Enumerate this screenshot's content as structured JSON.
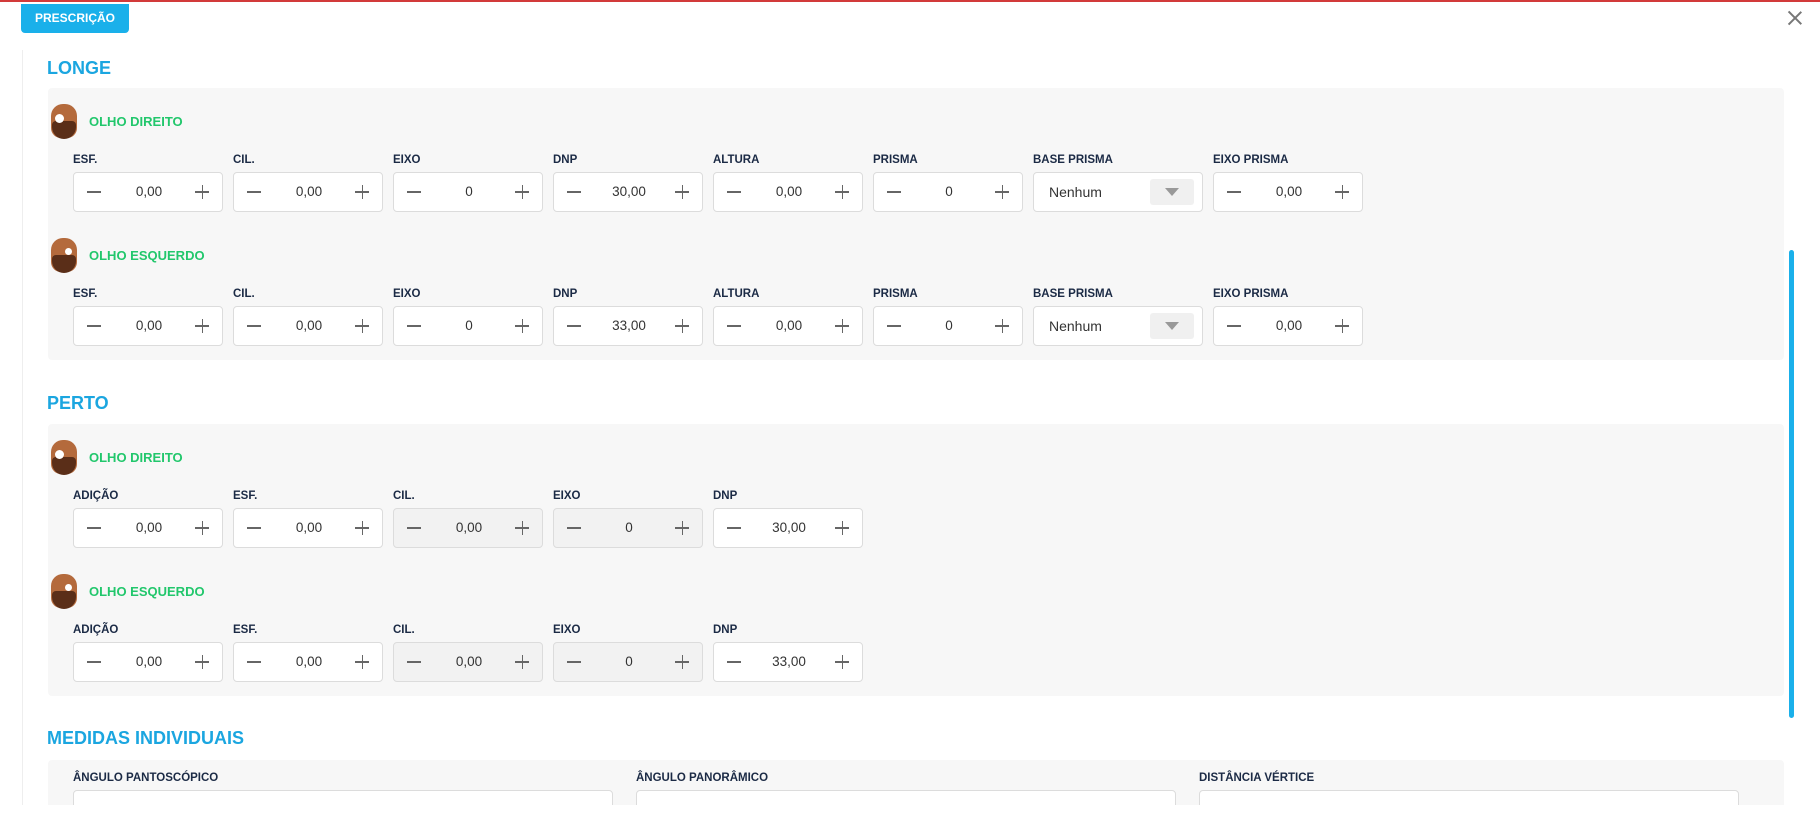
{
  "modal": {
    "tag_label": "PRESCRIÇÃO"
  },
  "longe": {
    "title": "LONGE",
    "olho_direito": {
      "label": "OLHO DIREITO",
      "fields": [
        {
          "label": "ESF.",
          "value": "0,00"
        },
        {
          "label": "CIL.",
          "value": "0,00"
        },
        {
          "label": "EIXO",
          "value": "0"
        },
        {
          "label": "DNP",
          "value": "30,00"
        },
        {
          "label": "ALTURA",
          "value": "0,00"
        },
        {
          "label": "PRISMA",
          "value": "0"
        }
      ],
      "base_prisma": {
        "label": "BASE PRISMA",
        "value": "Nenhum"
      },
      "eixo_prisma": {
        "label": "EIXO PRISMA",
        "value": "0,00"
      }
    },
    "olho_esquerdo": {
      "label": "OLHO ESQUERDO",
      "fields": [
        {
          "label": "ESF.",
          "value": "0,00"
        },
        {
          "label": "CIL.",
          "value": "0,00"
        },
        {
          "label": "EIXO",
          "value": "0"
        },
        {
          "label": "DNP",
          "value": "33,00"
        },
        {
          "label": "ALTURA",
          "value": "0,00"
        },
        {
          "label": "PRISMA",
          "value": "0"
        }
      ],
      "base_prisma": {
        "label": "BASE PRISMA",
        "value": "Nenhum"
      },
      "eixo_prisma": {
        "label": "EIXO PRISMA",
        "value": "0,00"
      }
    }
  },
  "perto": {
    "title": "PERTO",
    "olho_direito": {
      "label": "OLHO DIREITO",
      "fields": [
        {
          "label": "ADIÇÃO",
          "value": "0,00"
        },
        {
          "label": "ESF.",
          "value": "0,00"
        },
        {
          "label": "CIL.",
          "value": "0,00"
        },
        {
          "label": "EIXO",
          "value": "0"
        },
        {
          "label": "DNP",
          "value": "30,00"
        }
      ]
    },
    "olho_esquerdo": {
      "label": "OLHO ESQUERDO",
      "fields": [
        {
          "label": "ADIÇÃO",
          "value": "0,00"
        },
        {
          "label": "ESF.",
          "value": "0,00"
        },
        {
          "label": "CIL.",
          "value": "0,00"
        },
        {
          "label": "EIXO",
          "value": "0"
        },
        {
          "label": "DNP",
          "value": "33,00"
        }
      ]
    }
  },
  "medidas": {
    "title": "MEDIDAS INDIVIDUAIS",
    "fields": [
      {
        "label": "ÂNGULO PANTOSCÓPICO"
      },
      {
        "label": "ÂNGULO PANORÂMICO"
      },
      {
        "label": "DISTÂNCIA VÉRTICE"
      }
    ]
  }
}
